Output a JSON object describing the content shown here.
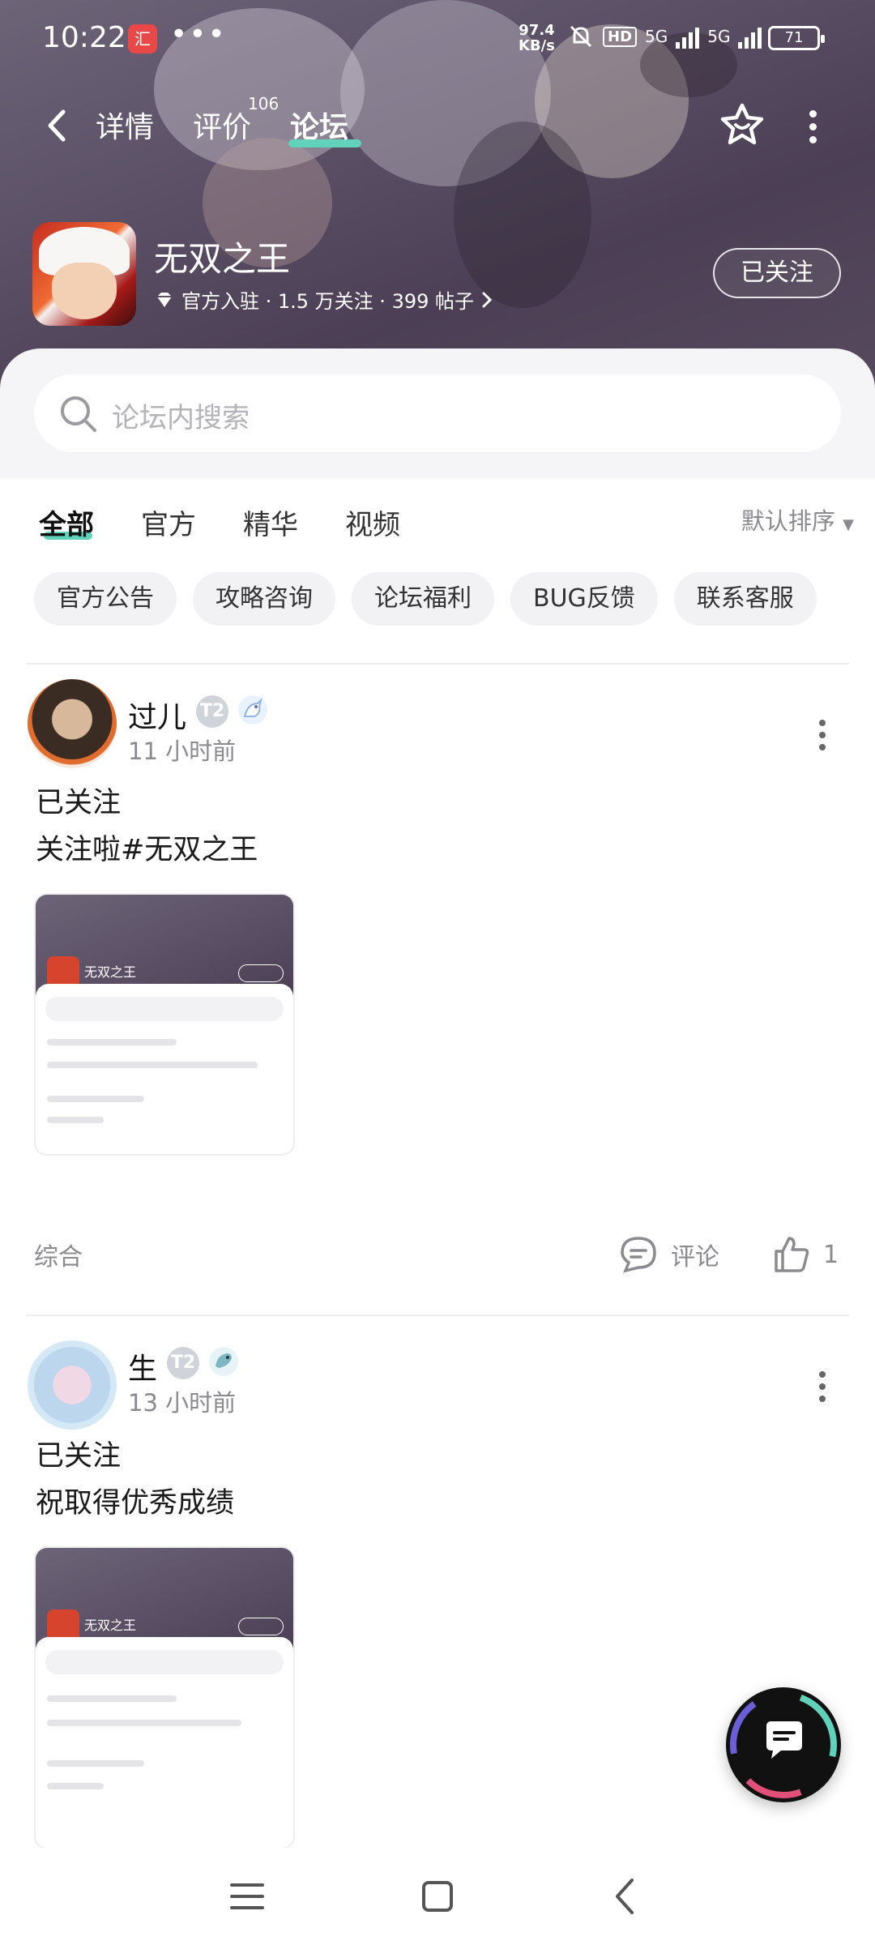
{
  "status_bar": {
    "time": "10:22",
    "app_badge": "汇",
    "more_dots": "•••",
    "net_speed_value": "97.4",
    "net_speed_unit": "KB/s",
    "hd_label": "HD",
    "net_1": "5G",
    "net_2": "5G",
    "battery": "71"
  },
  "top_nav": {
    "tabs": [
      {
        "label": "详情"
      },
      {
        "label": "评价",
        "badge": "106"
      },
      {
        "label": "论坛"
      }
    ],
    "active_tab": "论坛"
  },
  "game": {
    "title": "无双之王",
    "meta": "官方入驻 · 1.5 万关注 · 399 帖子",
    "follow_label": "已关注"
  },
  "search": {
    "placeholder": "论坛内搜索"
  },
  "filter_tabs": [
    "全部",
    "官方",
    "精华",
    "视频"
  ],
  "sort_label": "默认排序",
  "chips": [
    "官方公告",
    "攻略咨询",
    "论坛福利",
    "BUG反馈",
    "联系客服"
  ],
  "posts": [
    {
      "user": "过儿",
      "level": "T2",
      "time": "11 小时前",
      "title": "已关注",
      "body": "关注啦#无双之王",
      "thumb_title": "无双之王",
      "category": "综合",
      "comment_label": "评论",
      "likes": "1"
    },
    {
      "user": "生",
      "level": "T2",
      "time": "13 小时前",
      "title": "已关注",
      "body": "祝取得优秀成绩",
      "thumb_title": "无双之王"
    }
  ],
  "colors": {
    "accent": "#5fd2b9",
    "hero": "#5b5066"
  }
}
